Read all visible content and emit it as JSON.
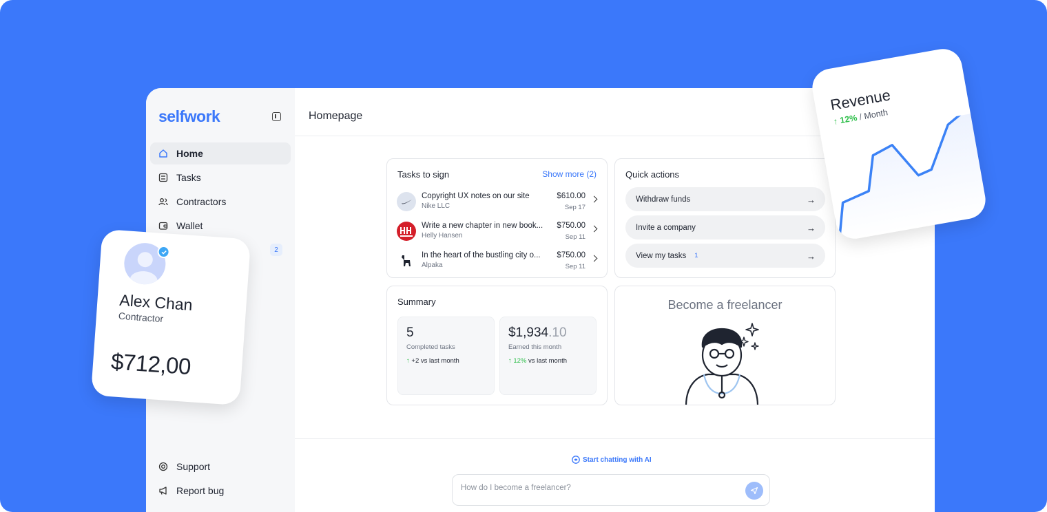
{
  "brand": {
    "logo": "selfwork",
    "accent": "#3b78fa",
    "background": "#3b78fa"
  },
  "sidebar": {
    "items": [
      {
        "label": "Home",
        "icon": "home-icon",
        "active": true
      },
      {
        "label": "Tasks",
        "icon": "tasks-icon",
        "active": false
      },
      {
        "label": "Contractors",
        "icon": "users-icon",
        "active": false
      },
      {
        "label": "Wallet",
        "icon": "wallet-icon",
        "active": false
      }
    ],
    "hidden_item_badge": "2",
    "footer": [
      {
        "label": "Support",
        "icon": "lifebuoy-icon"
      },
      {
        "label": "Report bug",
        "icon": "megaphone-icon"
      }
    ]
  },
  "header": {
    "title": "Homepage",
    "bell_icon": "bell-icon"
  },
  "tasks": {
    "title": "Tasks to sign",
    "show_more": "Show more (2)",
    "rows": [
      {
        "title": "Copyright UX notes on our site",
        "client": "Nike LLC",
        "amount": "$610.00",
        "date": "Sep 17"
      },
      {
        "title": "Write a new chapter in new book...",
        "client": "Helly Hansen",
        "amount": "$750.00",
        "date": "Sep 11"
      },
      {
        "title": "In the heart of the bustling city o...",
        "client": "Alpaka",
        "amount": "$750.00",
        "date": "Sep 11"
      }
    ]
  },
  "quick_actions": {
    "title": "Quick actions",
    "buttons": [
      {
        "label": "Withdraw funds",
        "count": ""
      },
      {
        "label": "Invite a company",
        "count": ""
      },
      {
        "label": "View my tasks",
        "count": "1"
      }
    ]
  },
  "summary": {
    "title": "Summary",
    "completed": {
      "value": "5",
      "label": "Completed tasks",
      "delta": "+2 vs last month"
    },
    "earned": {
      "value_main": "$1,934",
      "value_dec": ".10",
      "label": "Earned this month",
      "delta_pct": "12%",
      "delta_rest": " vs last month"
    }
  },
  "freelancer": {
    "title": "Become a freelancer"
  },
  "chat": {
    "link": "Start chatting with AI",
    "placeholder": "How do I become a freelancer?"
  },
  "profile": {
    "name": "Alex Chan",
    "role": "Contractor",
    "amount": "$712,00"
  },
  "revenue": {
    "title": "Revenue",
    "pct": "12%",
    "period": "Month"
  }
}
